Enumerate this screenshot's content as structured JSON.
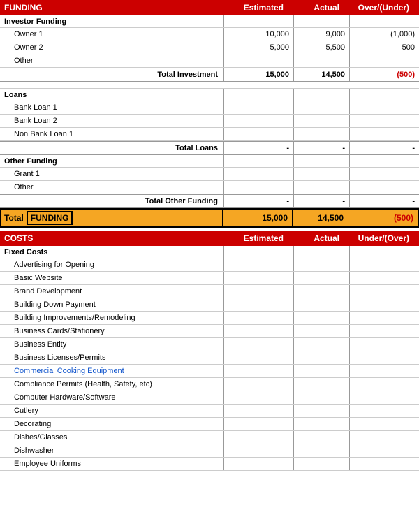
{
  "funding": {
    "header": {
      "label": "FUNDING",
      "col1": "Estimated",
      "col2": "Actual",
      "col3": "Over/(Under)"
    },
    "investor_funding": {
      "label": "Investor Funding",
      "items": [
        {
          "label": "Owner 1",
          "estimated": "10,000",
          "actual": "9,000",
          "over": "(1,000)",
          "over_red": true
        },
        {
          "label": "Owner 2",
          "estimated": "5,000",
          "actual": "5,500",
          "over": "500",
          "over_red": false
        },
        {
          "label": "Other",
          "estimated": "",
          "actual": "",
          "over": "",
          "over_red": false
        }
      ],
      "total_label": "Total Investment",
      "total_estimated": "15,000",
      "total_actual": "14,500",
      "total_over": "(500)",
      "total_over_red": true
    },
    "loans": {
      "label": "Loans",
      "items": [
        {
          "label": "Bank Loan 1",
          "estimated": "",
          "actual": "",
          "over": ""
        },
        {
          "label": "Bank Loan 2",
          "estimated": "",
          "actual": "",
          "over": ""
        },
        {
          "label": "Non Bank Loan 1",
          "estimated": "",
          "actual": "",
          "over": ""
        }
      ],
      "total_label": "Total Loans",
      "total_estimated": "-",
      "total_actual": "-",
      "total_over": "-"
    },
    "other_funding": {
      "label": "Other Funding",
      "items": [
        {
          "label": "Grant 1",
          "estimated": "",
          "actual": "",
          "over": ""
        },
        {
          "label": "Other",
          "estimated": "",
          "actual": "",
          "over": ""
        }
      ],
      "total_label": "Total Other Funding",
      "total_estimated": "-",
      "total_actual": "-",
      "total_over": "-"
    },
    "grand_total": {
      "label": "Total",
      "sublabel": "FUNDING",
      "estimated": "15,000",
      "actual": "14,500",
      "over": "(500)",
      "over_red": true
    }
  },
  "costs": {
    "header": {
      "label": "COSTS",
      "col1": "Estimated",
      "col2": "Actual",
      "col3": "Under/(Over)"
    },
    "fixed_costs": {
      "label": "Fixed Costs",
      "items": [
        {
          "label": "Advertising for Opening",
          "blue": false
        },
        {
          "label": "Basic Website",
          "blue": false
        },
        {
          "label": "Brand Development",
          "blue": false
        },
        {
          "label": "Building Down Payment",
          "blue": false
        },
        {
          "label": "Building Improvements/Remodeling",
          "blue": false
        },
        {
          "label": "Business Cards/Stationery",
          "blue": false
        },
        {
          "label": "Business Entity",
          "blue": false
        },
        {
          "label": "Business Licenses/Permits",
          "blue": false
        },
        {
          "label": "Commercial Cooking Equipment",
          "blue": true
        },
        {
          "label": "Compliance Permits (Health, Safety, etc)",
          "blue": false
        },
        {
          "label": "Computer Hardware/Software",
          "blue": false
        },
        {
          "label": "Cutlery",
          "blue": false
        },
        {
          "label": "Decorating",
          "blue": false
        },
        {
          "label": "Dishes/Glasses",
          "blue": false
        },
        {
          "label": "Dishwasher",
          "blue": false
        },
        {
          "label": "Employee Uniforms",
          "blue": false
        }
      ]
    }
  }
}
